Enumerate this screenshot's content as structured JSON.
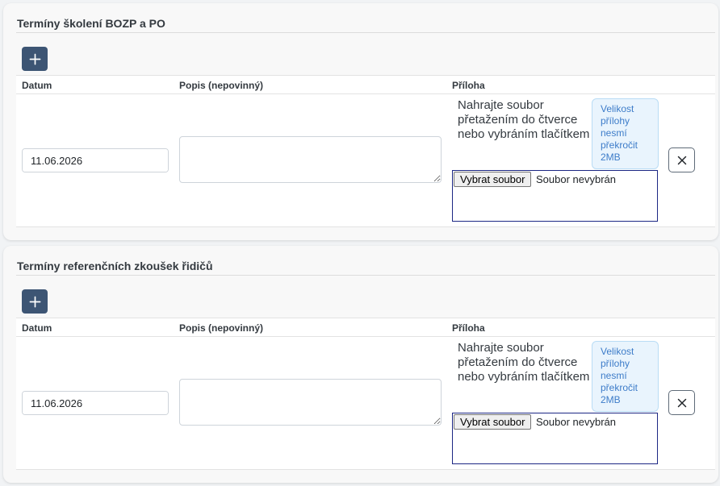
{
  "sections": [
    {
      "title": "Termíny školení BOZP a PO",
      "columns": {
        "date": "Datum",
        "description": "Popis (nepovinný)",
        "attachment": "Příloha"
      },
      "row": {
        "date_value": "11.06.2026",
        "description_value": "",
        "drop_text": "Nahrajte soubor přetažením do čtverce nebo vybráním tlačítkem",
        "size_note": "Velikost přílohy nesmí překročit 2MB",
        "choose_file_label": "Vybrat soubor",
        "file_status": "Soubor nevybrán"
      }
    },
    {
      "title": "Termíny referenčních zkoušek řidičů",
      "columns": {
        "date": "Datum",
        "description": "Popis (nepovinný)",
        "attachment": "Příloha"
      },
      "row": {
        "date_value": "11.06.2026",
        "description_value": "",
        "drop_text": "Nahrajte soubor přetažením do čtverce nebo vybráním tlačítkem",
        "size_note": "Velikost přílohy nesmí překročit 2MB",
        "choose_file_label": "Vybrat soubor",
        "file_status": "Soubor nevybrán"
      }
    }
  ],
  "icons": {
    "add": "plus-icon",
    "calendar": "calendar-icon",
    "remove": "close-icon"
  },
  "colors": {
    "primary": "#3d5574",
    "drop_zone_border": "#1c2784",
    "note_text": "#3d7cc9",
    "note_bg": "#e9f4fd"
  }
}
